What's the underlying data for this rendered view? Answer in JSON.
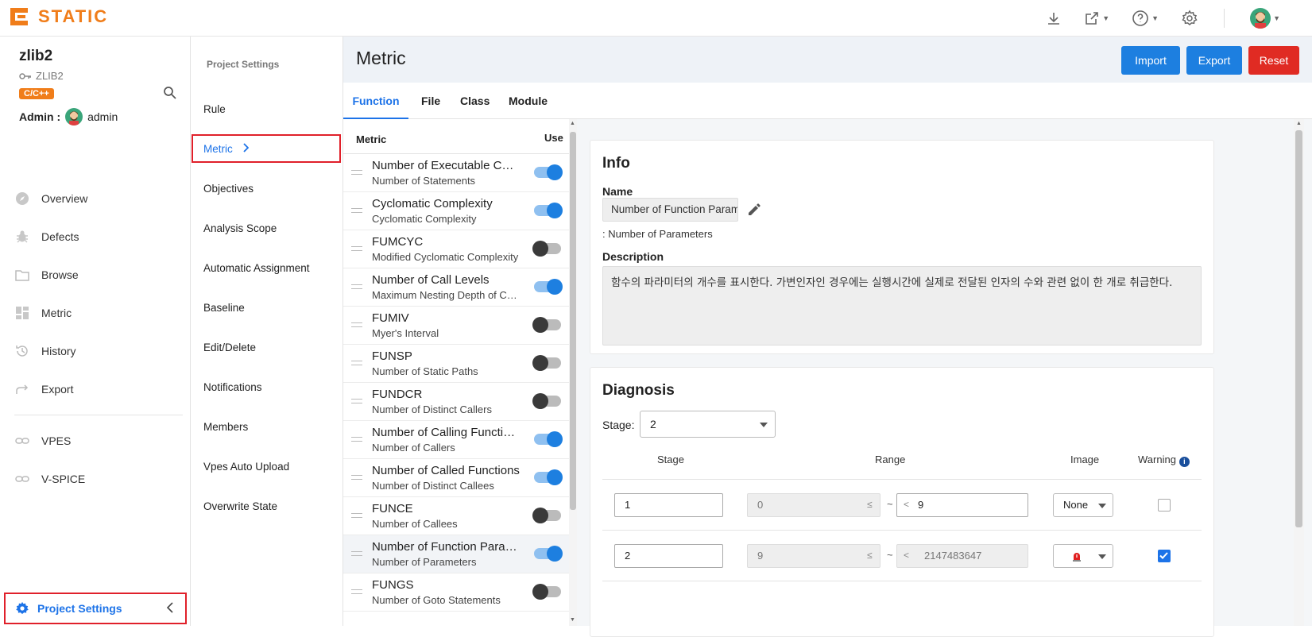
{
  "app": {
    "logo_text": "STATIC"
  },
  "topbar": {
    "icons": [
      "download-icon",
      "external-link-icon",
      "help-icon",
      "settings-icon",
      "user-avatar"
    ]
  },
  "project": {
    "name": "zlib2",
    "key": "ZLIB2",
    "language": "C/C++",
    "admin_label": "Admin :",
    "admin_user": "admin"
  },
  "nav": {
    "items": [
      {
        "label": "Overview",
        "icon": "compass-icon"
      },
      {
        "label": "Defects",
        "icon": "bug-icon"
      },
      {
        "label": "Browse",
        "icon": "folder-icon"
      },
      {
        "label": "Metric",
        "icon": "dashboard-icon"
      },
      {
        "label": "History",
        "icon": "history-icon"
      },
      {
        "label": "Export",
        "icon": "share-arrow-icon"
      }
    ],
    "links": [
      {
        "label": "VPES",
        "icon": "link-icon"
      },
      {
        "label": "V-SPICE",
        "icon": "link-icon"
      }
    ],
    "footer_label": "Project Settings"
  },
  "settings": {
    "title": "Project Settings",
    "items": [
      "Rule",
      "Metric",
      "Objectives",
      "Analysis Scope",
      "Automatic Assignment",
      "Baseline",
      "Edit/Delete",
      "Notifications",
      "Members",
      "Vpes Auto Upload",
      "Overwrite State"
    ],
    "active": "Metric"
  },
  "main": {
    "title": "Metric",
    "buttons": {
      "import": "Import",
      "export": "Export",
      "reset": "Reset"
    },
    "tabs": [
      "Function",
      "File",
      "Class",
      "Module"
    ],
    "active_tab": "Function"
  },
  "metric_list": {
    "col_metric": "Metric",
    "col_use": "Use",
    "rows": [
      {
        "name": "Number of Executable Code Lines",
        "desc": "Number of Statements",
        "on": true
      },
      {
        "name": "Cyclomatic Complexity",
        "desc": "Cyclomatic Complexity",
        "on": true
      },
      {
        "name": "FUMCYC",
        "desc": "Modified Cyclomatic Complexity",
        "on": false
      },
      {
        "name": "Number of Call Levels",
        "desc": "Maximum Nesting Depth of Control Structures",
        "on": true
      },
      {
        "name": "FUMIV",
        "desc": "Myer's Interval",
        "on": false
      },
      {
        "name": "FUNSP",
        "desc": "Number of Static Paths",
        "on": false
      },
      {
        "name": "FUNDCR",
        "desc": "Number of Distinct Callers",
        "on": false
      },
      {
        "name": "Number of Calling Functions",
        "desc": "Number of Callers",
        "on": true
      },
      {
        "name": "Number of Called Functions",
        "desc": "Number of Distinct Callees",
        "on": true
      },
      {
        "name": "FUNCE",
        "desc": "Number of Callees",
        "on": false
      },
      {
        "name": "Number of Function Parameters",
        "desc": "Number of Parameters",
        "on": true,
        "selected": true
      },
      {
        "name": "FUNGS",
        "desc": "Number of Goto Statements",
        "on": false
      }
    ]
  },
  "info": {
    "heading": "Info",
    "name_label": "Name",
    "name_value": "Number of Function Parameters",
    "name_sub": ": Number of Parameters",
    "desc_label": "Description",
    "desc_value": "함수의 파라미터의 개수를 표시한다. 가변인자인 경우에는 실행시간에 실제로 전달된 인자의 수와 관련 없이 한 개로 취급한다."
  },
  "diagnosis": {
    "heading": "Diagnosis",
    "stage_label": "Stage:",
    "stage_value": "2",
    "headers": {
      "stage": "Stage",
      "range": "Range",
      "image": "Image",
      "warning": "Warning"
    },
    "rows": [
      {
        "stage": "1",
        "from": "0",
        "le": "≤",
        "tilde": "~",
        "lt": "<",
        "to": "9",
        "image": "None",
        "warning": false
      },
      {
        "stage": "2",
        "from": "9",
        "le": "≤",
        "tilde": "~",
        "lt": "<",
        "to": "2147483647",
        "image": "",
        "warning": true
      }
    ]
  }
}
